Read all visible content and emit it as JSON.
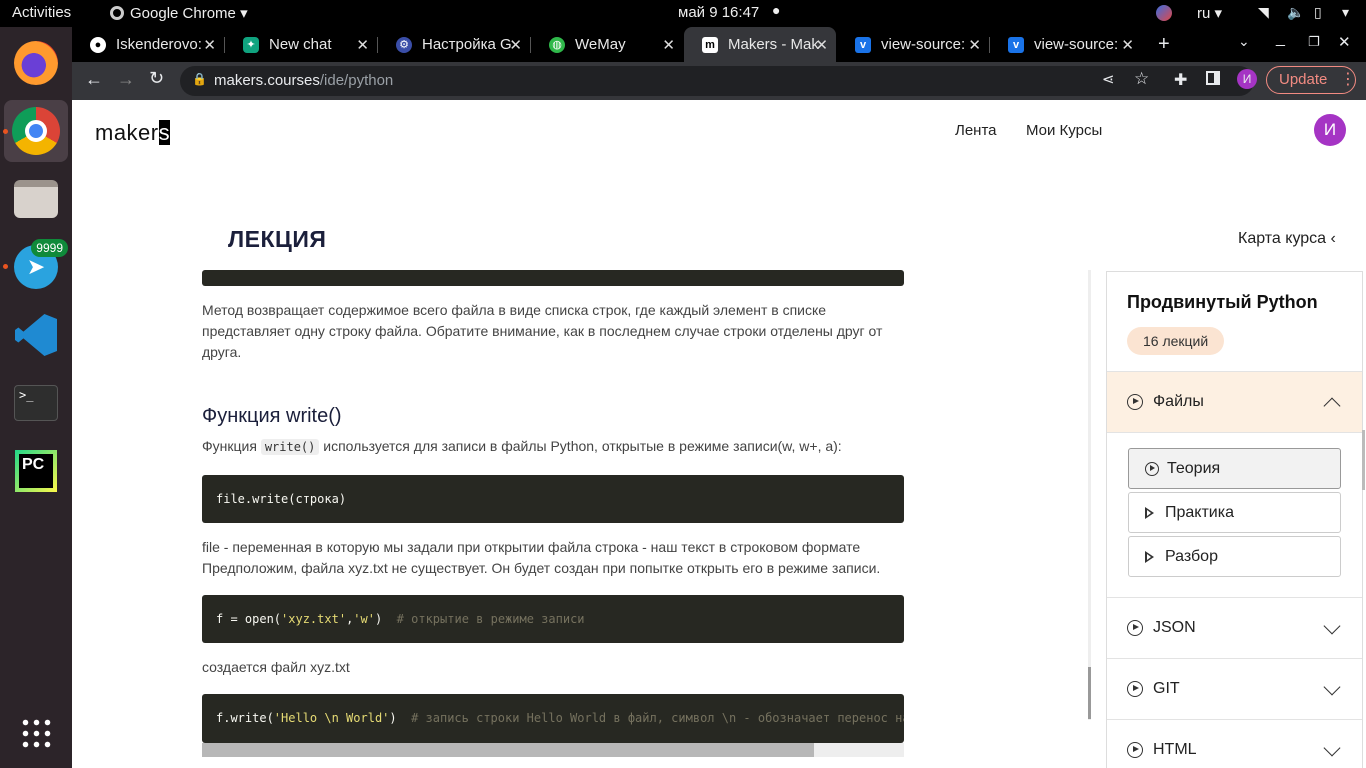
{
  "topbar": {
    "activities": "Activities",
    "app_name": "Google Chrome",
    "datetime": "май 9  16:47",
    "lang": "ru"
  },
  "dock": {
    "badge": "9999"
  },
  "tabs": [
    {
      "label": "Iskenderovo:",
      "icon": "github-icon"
    },
    {
      "label": "New chat",
      "icon": "chatgpt-icon"
    },
    {
      "label": "Настройка G",
      "icon": "settings-favicon"
    },
    {
      "label": "WeMay",
      "icon": "globe-icon"
    },
    {
      "label": "Makers - Mak",
      "icon": "makers-favicon"
    },
    {
      "label": "view-source:",
      "icon": "vercel-favicon"
    },
    {
      "label": "view-source:",
      "icon": "vercel-favicon"
    }
  ],
  "address": {
    "domain": "makers.courses",
    "path": "/ide/python"
  },
  "toolbar": {
    "profile_initial": "И",
    "update_label": "Update"
  },
  "header": {
    "logo": "maker",
    "logo_cursor": "s",
    "nav": [
      "Лента",
      "Мои Курсы"
    ],
    "avatar": "И"
  },
  "lecture": {
    "title": "ЛЕКЦИЯ",
    "course_map": "Карта курса ‹"
  },
  "content": {
    "para1": "Метод возвращает содержимое всего файла в виде списка строк, где каждый элемент в списке представляет одну строку файла. Обратите внимание, как в последнем случае строки отделены друг от друга.",
    "heading": "Функция write()",
    "para2_before": "Функция ",
    "para2_code": "write()",
    "para2_after": " используется для записи в файлы Python, открытые в режиме записи(w, w+, a):",
    "code1": "file.write(строка)",
    "para3": "file - переменная в которую мы задали при открытии файла строка - наш текст в строковом формате Предположим, файла xyz.txt не существует. Он будет создан при попытке открыть его в режиме записи.",
    "code2_a": "f = open(",
    "code2_s1": "'xyz.txt'",
    "code2_b": ",",
    "code2_s2": "'w'",
    "code2_c": ")  ",
    "code2_comment": "# открытие в режиме записи",
    "para4": "создается файл xyz.txt",
    "code3_a": "f.write(",
    "code3_s": "'Hello \\n World'",
    "code3_b": ")  ",
    "code3_comment": "# запись строки Hello World в файл, символ \\n - обозначает перенос на но"
  },
  "sidebar": {
    "course": "Продвинутый Python",
    "lectures": "16 лекций",
    "modules": [
      "Файлы",
      "JSON",
      "GIT",
      "HTML"
    ],
    "lessons": [
      "Теория",
      "Практика",
      "Разбор"
    ]
  }
}
